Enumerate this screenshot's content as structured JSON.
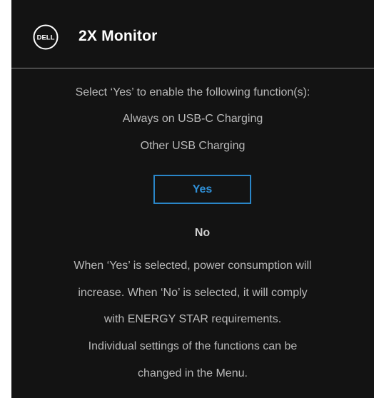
{
  "header": {
    "logo_text": "DELL",
    "title": "2X Monitor"
  },
  "prompt": {
    "instruction": "Select ‘Yes’ to enable the following function(s):",
    "functions": [
      "Always on USB-C Charging",
      "Other USB Charging"
    ]
  },
  "buttons": {
    "yes_label": "Yes",
    "no_label": "No",
    "selected": "Yes"
  },
  "notice": {
    "lines": [
      "When ‘Yes’ is selected, power consumption will",
      "increase. When ‘No’ is selected, it will comply",
      "with ENERGY STAR requirements.",
      "Individual settings of the functions can be",
      "changed in the Menu."
    ]
  },
  "colors": {
    "background": "#131313",
    "accent": "#2a86c8",
    "title": "#ffffff",
    "text": "#b9b9b9"
  }
}
